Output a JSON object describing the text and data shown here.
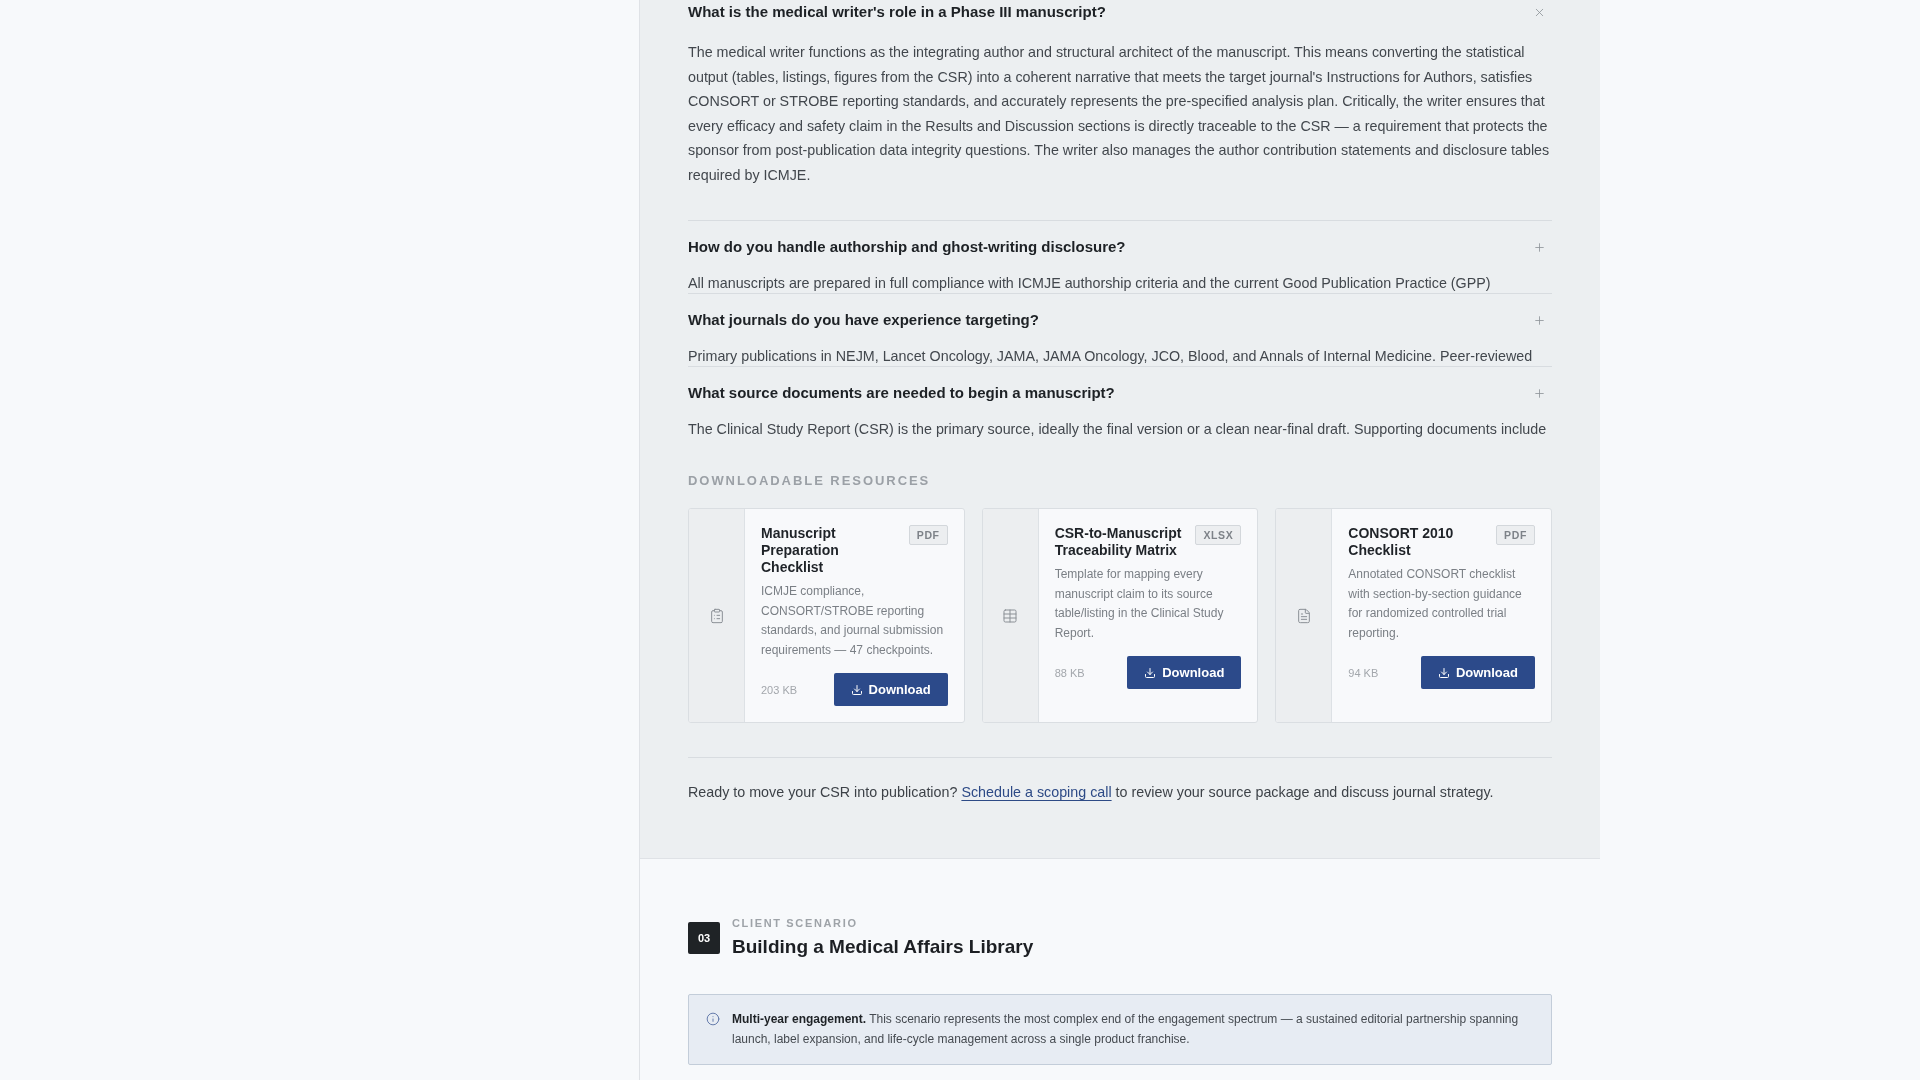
{
  "faq": [
    {
      "question": "What is the medical writer's role in a Phase III manuscript?",
      "answer": "The medical writer functions as the integrating author and structural architect of the manuscript. This means converting the statistical output (tables, listings, figures from the CSR) into a coherent narrative that meets the target journal's Instructions for Authors, satisfies CONSORT or STROBE reporting standards, and accurately represents the pre-specified analysis plan. Critically, the writer ensures that every efficacy and safety claim in the Results and Discussion sections is directly traceable to the CSR — a requirement that protects the sponsor from post-publication data integrity questions. The writer also manages the author contribution statements and disclosure tables required by ICMJE.",
      "expanded": true
    },
    {
      "question": "How do you handle authorship and ghost-writing disclosure?",
      "answer": "All manuscripts are prepared in full compliance with ICMJE authorship criteria and the current Good Publication Practice (GPP)",
      "expanded": false
    },
    {
      "question": "What journals do you have experience targeting?",
      "answer": "Primary publications in NEJM, Lancet Oncology, JAMA, JAMA Oncology, JCO, Blood, and Annals of Internal Medicine. Peer-reviewed",
      "expanded": false
    },
    {
      "question": "What source documents are needed to begin a manuscript?",
      "answer": "The Clinical Study Report (CSR) is the primary source, ideally the final version or a clean near-final draft. Supporting documents include",
      "expanded": false
    }
  ],
  "resources": {
    "heading": "DOWNLOADABLE RESOURCES",
    "items": [
      {
        "title": "Manuscript Preparation Checklist",
        "format": "PDF",
        "description": "ICMJE compliance, CONSORT/STROBE reporting standards, and journal submission requirements — 47 checkpoints.",
        "size": "203 KB",
        "button": "Download"
      },
      {
        "title": "CSR-to-Manuscript Traceability Matrix",
        "format": "XLSX",
        "description": "Template for mapping every manuscript claim to its source table/listing in the Clinical Study Report.",
        "size": "88 KB",
        "button": "Download"
      },
      {
        "title": "CONSORT 2010 Checklist",
        "format": "PDF",
        "description": "Annotated CONSORT checklist with section-by-section guidance for randomized controlled trial reporting.",
        "size": "94 KB",
        "button": "Download"
      }
    ]
  },
  "cta": {
    "text_before": "Ready to move your CSR into publication?",
    "link": "Schedule a scoping call",
    "text_after": "to review your source package and discuss journal strategy."
  },
  "scenario": {
    "number": "03",
    "eyebrow": "CLIENT SCENARIO",
    "title": "Building a Medical Affairs Library",
    "note": "**Multi-year engagement.** This scenario represents the most complex end of the engagement spectrum — a sustained editorial partnership spanning launch, label expansion, and life-cycle management across a single product franchise."
  }
}
